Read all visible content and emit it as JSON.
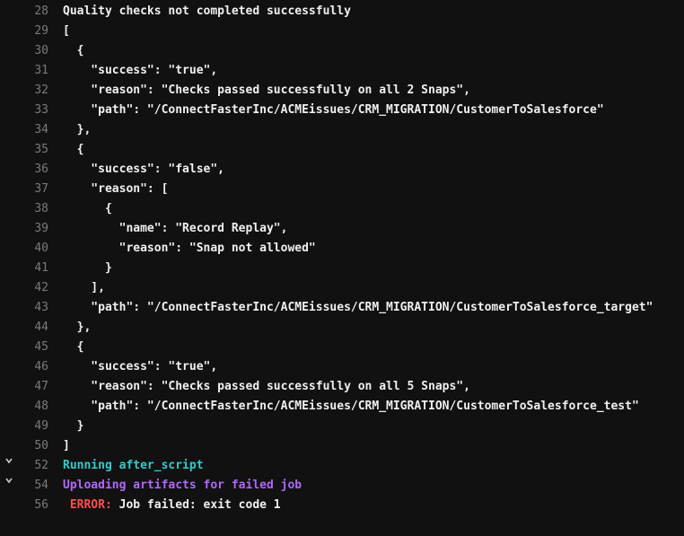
{
  "lines": [
    {
      "n": 28,
      "cls": "c-white",
      "indent": 0,
      "text": "Quality checks not completed successfully"
    },
    {
      "n": 29,
      "cls": "c-white",
      "indent": 0,
      "text": "["
    },
    {
      "n": 30,
      "cls": "c-white",
      "indent": 1,
      "text": "{"
    },
    {
      "n": 31,
      "cls": "c-white",
      "indent": 2,
      "text": "\"success\": \"true\","
    },
    {
      "n": 32,
      "cls": "c-white",
      "indent": 2,
      "text": "\"reason\": \"Checks passed successfully on all 2 Snaps\","
    },
    {
      "n": 33,
      "cls": "c-white",
      "indent": 2,
      "text": "\"path\": \"/ConnectFasterInc/ACMEissues/CRM_MIGRATION/CustomerToSalesforce\""
    },
    {
      "n": 34,
      "cls": "c-white",
      "indent": 1,
      "text": "},"
    },
    {
      "n": 35,
      "cls": "c-white",
      "indent": 1,
      "text": "{"
    },
    {
      "n": 36,
      "cls": "c-white",
      "indent": 2,
      "text": "\"success\": \"false\","
    },
    {
      "n": 37,
      "cls": "c-white",
      "indent": 2,
      "text": "\"reason\": ["
    },
    {
      "n": 38,
      "cls": "c-white",
      "indent": 3,
      "text": "{"
    },
    {
      "n": 39,
      "cls": "c-white",
      "indent": 4,
      "text": "\"name\": \"Record Replay\","
    },
    {
      "n": 40,
      "cls": "c-white",
      "indent": 4,
      "text": "\"reason\": \"Snap not allowed\""
    },
    {
      "n": 41,
      "cls": "c-white",
      "indent": 3,
      "text": "}"
    },
    {
      "n": 42,
      "cls": "c-white",
      "indent": 2,
      "text": "],"
    },
    {
      "n": 43,
      "cls": "c-white",
      "indent": 2,
      "text": "\"path\": \"/ConnectFasterInc/ACMEissues/CRM_MIGRATION/CustomerToSalesforce_target\""
    },
    {
      "n": 44,
      "cls": "c-white",
      "indent": 1,
      "text": "},"
    },
    {
      "n": 45,
      "cls": "c-white",
      "indent": 1,
      "text": "{"
    },
    {
      "n": 46,
      "cls": "c-white",
      "indent": 2,
      "text": "\"success\": \"true\","
    },
    {
      "n": 47,
      "cls": "c-white",
      "indent": 2,
      "text": "\"reason\": \"Checks passed successfully on all 5 Snaps\","
    },
    {
      "n": 48,
      "cls": "c-white",
      "indent": 2,
      "text": "\"path\": \"/ConnectFasterInc/ACMEissues/CRM_MIGRATION/CustomerToSalesforce_test\""
    },
    {
      "n": 49,
      "cls": "c-white",
      "indent": 1,
      "text": "}"
    },
    {
      "n": 50,
      "cls": "c-white",
      "indent": 0,
      "text": "]"
    },
    {
      "n": 52,
      "cls": "c-teal",
      "indent": 0,
      "text": "Running after_script",
      "fold": true
    },
    {
      "n": 54,
      "cls": "c-purple",
      "indent": 0,
      "text": "Uploading artifacts for failed job",
      "fold": true
    },
    {
      "n": 56,
      "cls": "",
      "indent": 0,
      "segments": [
        {
          "cls": "c-red",
          "text": " ERROR: "
        },
        {
          "cls": "c-white",
          "text": "Job failed: exit code 1"
        }
      ]
    }
  ],
  "indent_unit": "  "
}
